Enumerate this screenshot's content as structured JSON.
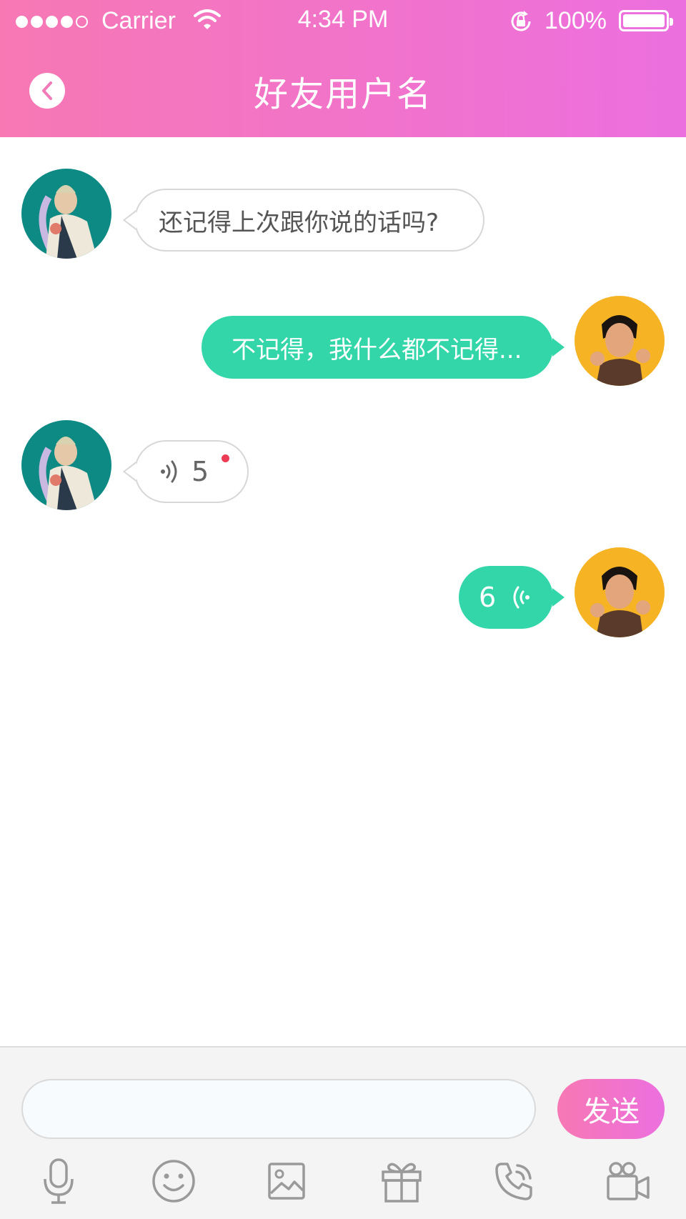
{
  "status_bar": {
    "carrier": "Carrier",
    "time": "4:34 PM",
    "battery_percent": "100%",
    "signal_bars": 4,
    "signal_total": 5
  },
  "nav": {
    "title": "好友用户名",
    "back_icon": "chevron-left-icon"
  },
  "messages": [
    {
      "sender": "friend",
      "type": "text",
      "text": "还记得上次跟你说的话吗?"
    },
    {
      "sender": "me",
      "type": "text",
      "text": "不记得，我什么都不记得..."
    },
    {
      "sender": "friend",
      "type": "voice",
      "duration": "5",
      "unread": true
    },
    {
      "sender": "me",
      "type": "voice",
      "duration": "6"
    }
  ],
  "composer": {
    "input_value": "",
    "send_label": "发送"
  },
  "toolbar": [
    "microphone-icon",
    "emoji-icon",
    "image-icon",
    "gift-icon",
    "phone-call-icon",
    "video-call-icon"
  ],
  "colors": {
    "header_start": "#f778b3",
    "header_end": "#ec6fdf",
    "my_bubble": "#33d6a8",
    "friend_avatar_bg": "#0d8a84",
    "my_avatar_bg": "#f6b425",
    "unread_dot": "#ec3b54"
  }
}
